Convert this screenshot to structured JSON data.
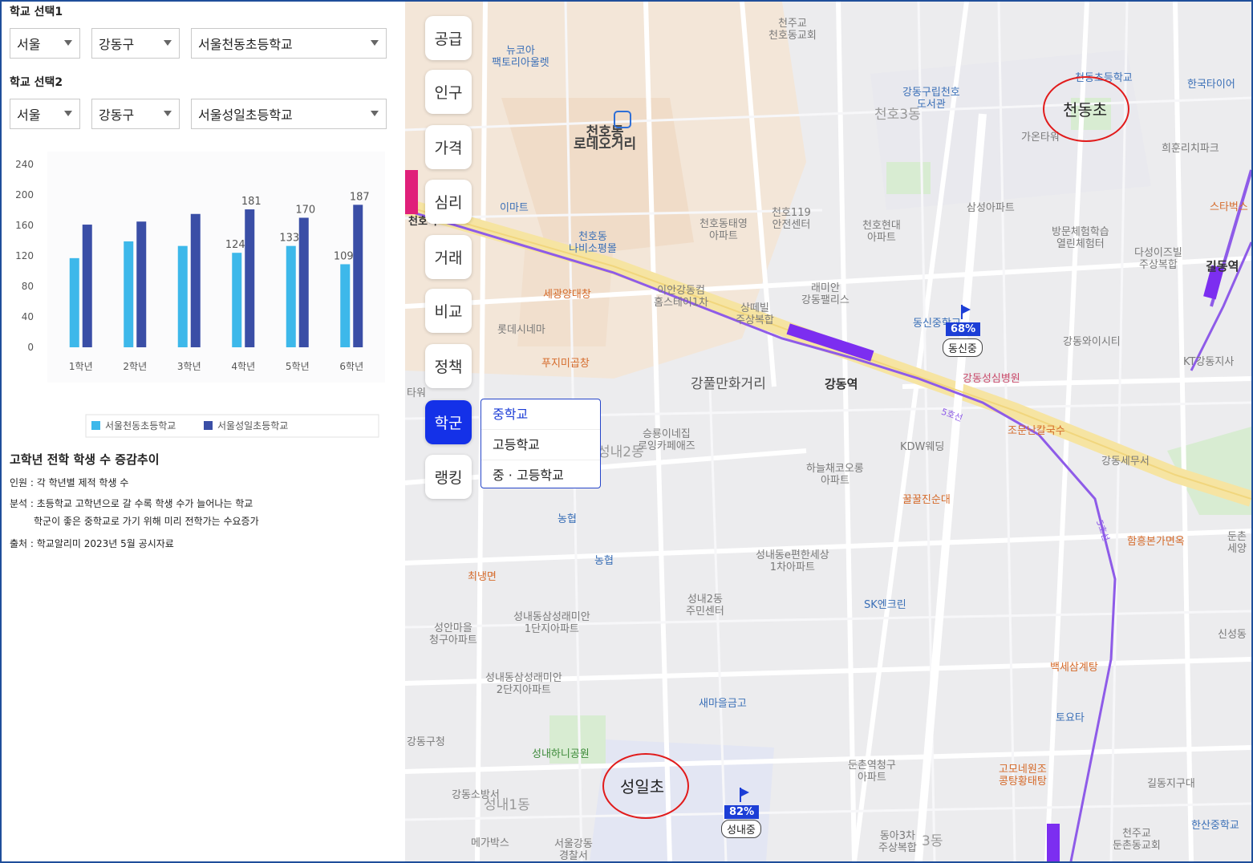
{
  "school1": {
    "title": "학교 선택1",
    "region": "서울",
    "district": "강동구",
    "school": "서울천동초등학교"
  },
  "school2": {
    "title": "학교 선택2",
    "region": "서울",
    "district": "강동구",
    "school": "서울성일초등학교"
  },
  "chart_data": {
    "type": "bar",
    "categories": [
      "1학년",
      "2학년",
      "3학년",
      "4학년",
      "5학년",
      "6학년"
    ],
    "series": [
      {
        "name": "서울천동초등학교",
        "values": [
          117,
          139,
          133,
          124,
          133,
          109
        ],
        "color": "#3db8ea"
      },
      {
        "name": "서울성일초등학교",
        "values": [
          161,
          165,
          175,
          181,
          170,
          187
        ],
        "color": "#3a4ea6"
      }
    ],
    "data_labels": {
      "서울천동초등학교": [
        "",
        "",
        "",
        "124",
        "133",
        "109"
      ],
      "서울성일초등학교": [
        "",
        "",
        "",
        "181",
        "170",
        "187"
      ]
    },
    "ylim": [
      0,
      240
    ],
    "yticks": [
      0,
      40,
      80,
      120,
      160,
      200,
      240
    ],
    "legend": "bottom",
    "grid": false
  },
  "notes": {
    "title": "고학년 전학 학생 수 증감추이",
    "line1": "인원 : 각 학년별 제적 학생 수",
    "line2": "분석 : 초등학교 고학년으로 갈 수록 학생 수가 늘어나는 학교",
    "line3": "학군이 좋은 중학교로 가기 위해 미리 전학가는 수요증가",
    "line4": "출처 : 학교알리미 2023년 5월 공시자료"
  },
  "menu": {
    "items": [
      "공급",
      "인구",
      "가격",
      "심리",
      "거래",
      "비교",
      "정책",
      "학군",
      "랭킹"
    ],
    "active": "학군"
  },
  "dropdown": {
    "items": [
      "중학교",
      "고등학교",
      "중 · 고등학교"
    ]
  },
  "map": {
    "markers": {
      "cheondong": "천동초",
      "seongil": "성일초"
    },
    "badges": {
      "dongsin_pct": "68%",
      "dongsin_name": "동신중",
      "seongnae_pct": "82%",
      "seongnae_name": "성내중"
    },
    "labels": {
      "cheonju_church": "천주교\n천호동교회",
      "newcore": "뉴코아\n팩토리아울렛",
      "cheonho_rodeo": "천호동\n로데오거리",
      "gangdong_library": "강동구립천호\n도서관",
      "cheonho3": "천호3동",
      "cheondong_school_poi": "천동초등학교",
      "hankook_tire": "한국타이어",
      "gaonta": "가온타워",
      "heehun": "희훈리치파크",
      "emart": "이마트",
      "cheonho_dongtaeyoung": "천호동태영\n아파트",
      "cheonho119": "천호119\n안전센터",
      "cheonho_hyundai": "천호현대\n아파트",
      "samsung_apt": "삼성아파트",
      "starbucks": "스타벅스",
      "nabiso": "천호동\n나비소평몰",
      "visit_center": "방문체험학습\n열린체험터",
      "dasung": "다성이즈빌\n주상복합",
      "gildong_stn": "길동역",
      "seogwang": "세광양대창",
      "ian": "이안강동컴\n홈스테이1차",
      "sangtae": "상떼빌\n주상복합",
      "raemian": "래미안\n강동팰리스",
      "dongsin_school": "동신중학교",
      "lotte_cinema": "롯데시네마",
      "gangdong_wisity": "강동와이시티",
      "puji": "푸지미곱창",
      "gangpul": "강풀만화거리",
      "gangdong_stn": "강동역",
      "seongsim": "강동성심병원",
      "kt": "KT강동지사",
      "seungryong": "승룡이네집\n로잉카페애즈",
      "seongnae2": "성내2동",
      "kdw": "KDW웨딩",
      "jomun": "조문난칼국수",
      "gangdong_tax": "강동세무서",
      "haneul": "하늘채코오롱\n아파트",
      "nh1": "농협",
      "kkul": "꿀꿀진순대",
      "hamheung": "함흥본가면옥",
      "nh2": "농협",
      "choi": "최냉면",
      "seongnae_e": "성내동e편한세상\n1차아파트",
      "seongnae2_center": "성내2동\n주민센터",
      "sk": "SK엔크린",
      "seongan": "성안마을\n청구아파트",
      "seongnae_samsung1": "성내동삼성래미안\n1단지아파트",
      "baekse": "백세삼계탕",
      "seongnae_samsung2": "성내동삼성래미안\n2단지아파트",
      "saemaeul": "새마을금고",
      "toyota": "토요타",
      "gangdong_gu_office": "강동구청",
      "seongnae_park": "성내하니공원",
      "dunchon_chunggu": "둔촌역청구\n아파트",
      "gomonet": "고모네원조\n콩탕황태탕",
      "gildong_center": "길동지구대",
      "gangdong_fire": "강동소방서",
      "seongnae1": "성내1동",
      "megabox": "메가박스",
      "seoul_gangdong": "서울강동\n경찰서",
      "donga": "동아3차\n주상복합",
      "dong3": "3동",
      "cheonju_dunchon": "천주교\n둔촌동교회",
      "hansan": "한산중학교",
      "sinseong": "신성동",
      "dunchon_right": "둔촌\n세양",
      "tabo": "타워",
      "cheonho_stn": "천호역",
      "line5_a": "5호선",
      "line5_b": "5호선"
    }
  }
}
